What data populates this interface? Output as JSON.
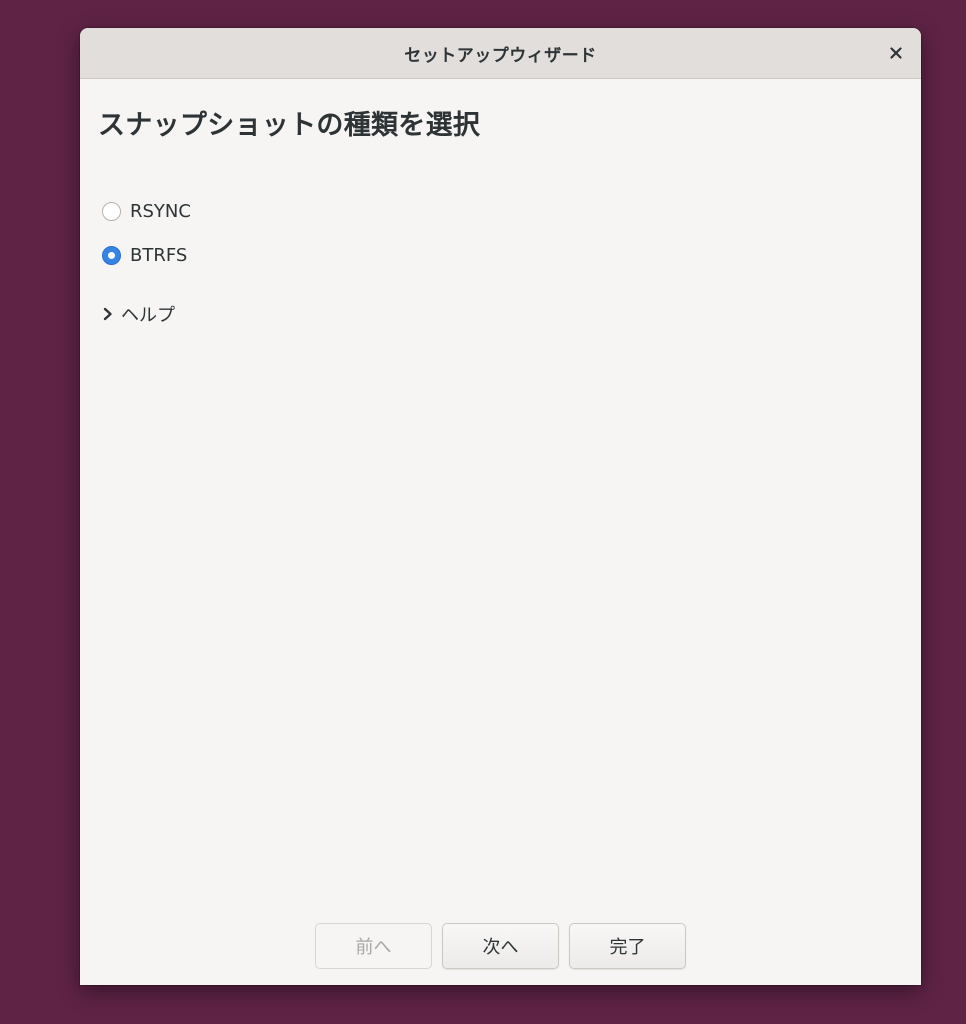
{
  "window": {
    "title": "セットアップウィザード"
  },
  "page": {
    "heading": "スナップショットの種類を選択"
  },
  "snapshot_type": {
    "options": [
      {
        "label": "RSYNC",
        "selected": false
      },
      {
        "label": "BTRFS",
        "selected": true
      }
    ]
  },
  "help": {
    "label": "ヘルプ",
    "expanded": false
  },
  "buttons": {
    "prev": "前へ",
    "next": "次へ",
    "finish": "完了"
  },
  "colors": {
    "desktop_background": "#5f2346",
    "window_background": "#f6f5f4",
    "titlebar": "#e1dedb",
    "accent": "#3584e4"
  }
}
